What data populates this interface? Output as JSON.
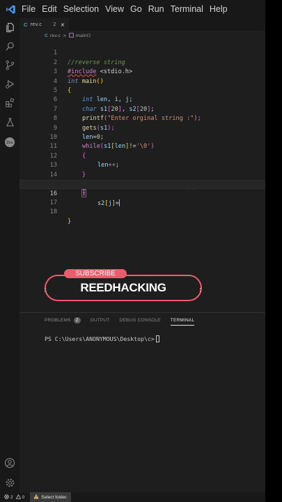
{
  "menu": [
    "File",
    "Edit",
    "Selection",
    "View",
    "Go",
    "Run",
    "Terminal",
    "Help"
  ],
  "tabs": [
    {
      "label": "rev.c",
      "number": "2",
      "close": "×"
    }
  ],
  "breadcrumb": {
    "file": "rev.c",
    "sep": ">",
    "symbol": "main()"
  },
  "editor": {
    "lines": [
      "1",
      "2",
      "3",
      "4",
      "5",
      "6",
      "7",
      "8",
      "9",
      "10",
      "11",
      "12",
      "13",
      "14",
      "15",
      "16",
      "17",
      "18"
    ],
    "current_line": 16,
    "code": {
      "l1": "//reverse string",
      "l2a": "#include",
      "l2b": " <stdio.h>",
      "l3a": "int",
      "l3b": " main",
      "l3c": "()",
      "l4": "{",
      "l5a": "int",
      "l5b": " len, i, j;",
      "l6a": "char",
      "l6b": " s1",
      "l6c": "[",
      "l6d": "20",
      "l6e": "]",
      "l6f": ", s2",
      "l6g": "[",
      "l6h": "20",
      "l6i": "]",
      "l6j": ";",
      "l7a": "printf",
      "l7b": "(",
      "l7c": "\"Enter orginal string :\"",
      "l7d": ");",
      "l8a": "gets",
      "l8b": "(",
      "l8c": "s1",
      "l8d": ");",
      "l9a": "len",
      "l9b": "=",
      "l9c": "0",
      "l9d": ";",
      "l10a": "while",
      "l10b": "(",
      "l10c": "s1",
      "l10d": "[",
      "l10e": "len",
      "l10f": "]",
      "l10g": "!=",
      "l10h": "'\\0'",
      "l10i": ")",
      "l11": "{",
      "l12a": "len",
      "l12b": "++",
      "l12c": ";",
      "l13": "}",
      "l14a": "for",
      "l14b": "(",
      "l14c": "i",
      "l14d": "=",
      "l14e": "0",
      "l14f": ",",
      "l14g": "j",
      "l14h": "=",
      "l14i": "len",
      "l14j": "-",
      "l14k": "1",
      "l14l": "; ",
      "l14m": "i",
      "l14n": "<",
      "l14o": "len",
      "l14p": "; ",
      "l14q": "i",
      "l14r": "++",
      "l14s": ",",
      "l14t": "J",
      "l14u": "--",
      "l14v": ")",
      "l15": "{",
      "l16a": "s2",
      "l16b": "[",
      "l16c": "j",
      "l16d": "]",
      "l16e": "=",
      "l17": "}",
      "l18": "}"
    }
  },
  "banner": {
    "subscribe": "SUBSCRIBE",
    "brand": "REEDHACKING"
  },
  "panel": {
    "tabs": [
      "PROBLEMS",
      "OUTPUT",
      "DEBUG CONSOLE",
      "TERMINAL"
    ],
    "problems_count": "2",
    "active_tab": "TERMINAL",
    "prompt": "PS C:\\Users\\ANONYMOUS\\Desktop\\c>"
  },
  "status": {
    "errors": "2",
    "warnings": "0",
    "message": "Select folder."
  },
  "colors": {
    "accent": "#ef5b6c",
    "vscode_blue": "#3b9cff"
  }
}
